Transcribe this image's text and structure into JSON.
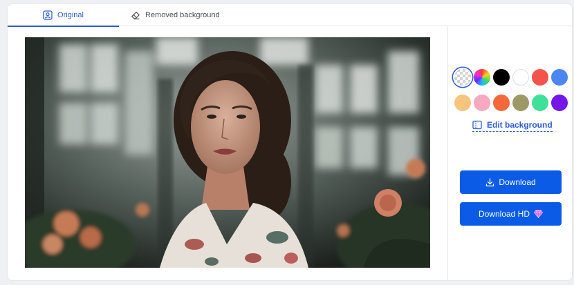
{
  "tabs": [
    {
      "label": "Original",
      "icon": "portrait-icon",
      "active": true
    },
    {
      "label": "Removed background",
      "icon": "eraser-icon",
      "active": false
    }
  ],
  "swatches": [
    {
      "name": "transparent",
      "color": "checkerboard",
      "selected": true
    },
    {
      "name": "rainbow",
      "color": "gradient"
    },
    {
      "name": "black",
      "color": "#000000"
    },
    {
      "name": "white",
      "color": "#ffffff"
    },
    {
      "name": "red",
      "color": "#f5524b"
    },
    {
      "name": "blue",
      "color": "#4d86f0"
    },
    {
      "name": "peach",
      "color": "#f7c47e"
    },
    {
      "name": "pink",
      "color": "#f6a9c0"
    },
    {
      "name": "orange",
      "color": "#f5683a"
    },
    {
      "name": "olive",
      "color": "#9e9864"
    },
    {
      "name": "green",
      "color": "#3fe09a"
    },
    {
      "name": "purple",
      "color": "#7417e8"
    }
  ],
  "edit_background": {
    "label": "Edit background",
    "icon": "edit-background-icon"
  },
  "buttons": {
    "download": {
      "label": "Download",
      "icon": "download-icon"
    },
    "download_hd": {
      "label": "Download HD",
      "icon": "diamond-icon"
    }
  },
  "colors": {
    "accent": "#2d5bd7",
    "button": "#0b5be6"
  }
}
